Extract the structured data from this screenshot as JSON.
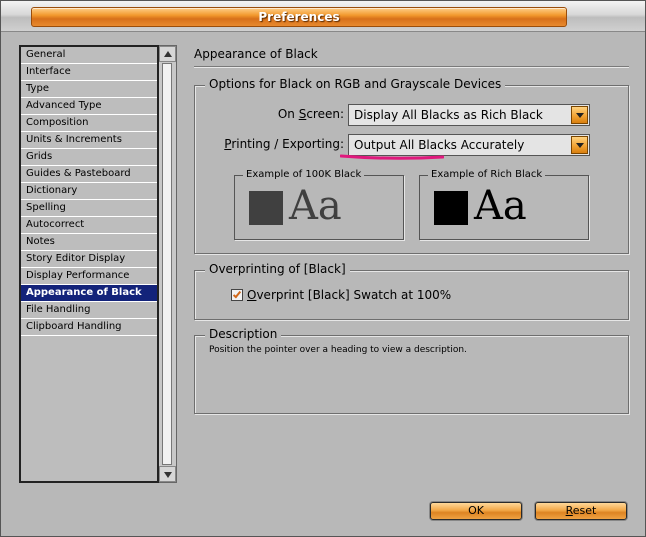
{
  "window": {
    "title": "Preferences"
  },
  "sidebar": {
    "items": [
      {
        "label": "General",
        "selected": false
      },
      {
        "label": "Interface",
        "selected": false
      },
      {
        "label": "Type",
        "selected": false
      },
      {
        "label": "Advanced Type",
        "selected": false
      },
      {
        "label": "Composition",
        "selected": false
      },
      {
        "label": "Units & Increments",
        "selected": false
      },
      {
        "label": "Grids",
        "selected": false
      },
      {
        "label": "Guides & Pasteboard",
        "selected": false
      },
      {
        "label": "Dictionary",
        "selected": false
      },
      {
        "label": "Spelling",
        "selected": false
      },
      {
        "label": "Autocorrect",
        "selected": false
      },
      {
        "label": "Notes",
        "selected": false
      },
      {
        "label": "Story Editor Display",
        "selected": false
      },
      {
        "label": "Display Performance",
        "selected": false
      },
      {
        "label": "Appearance of Black",
        "selected": true
      },
      {
        "label": "File Handling",
        "selected": false
      },
      {
        "label": "Clipboard Handling",
        "selected": false
      }
    ]
  },
  "main": {
    "heading": "Appearance of Black",
    "options_group": {
      "legend": "Options for Black on RGB and Grayscale Devices",
      "on_screen": {
        "label_pre": "On ",
        "label_ul": "S",
        "label_post": "creen:",
        "value": "Display All Blacks as Rich Black"
      },
      "printing": {
        "label_ul": "P",
        "label_post": "rinting / Exporting:",
        "value": "Output All Blacks Accurately"
      },
      "example_100k": {
        "legend": "Example of 100K Black",
        "sample": "Aa",
        "color": "#404040"
      },
      "example_rich": {
        "legend": "Example of Rich Black",
        "sample": "Aa",
        "color": "#000000"
      }
    },
    "overprint_group": {
      "legend": "Overprinting of [Black]",
      "checkbox": {
        "label_ul": "O",
        "label_post": "verprint [Black] Swatch at 100%",
        "checked": true
      }
    },
    "description_group": {
      "legend": "Description",
      "text": "Position the pointer over a heading to view a description."
    }
  },
  "buttons": {
    "ok": "OK",
    "reset_ul": "R",
    "reset_post": "eset"
  },
  "colors": {
    "accent": "#f0a030",
    "selection": "#13237a",
    "highlight": "#e0197d"
  }
}
